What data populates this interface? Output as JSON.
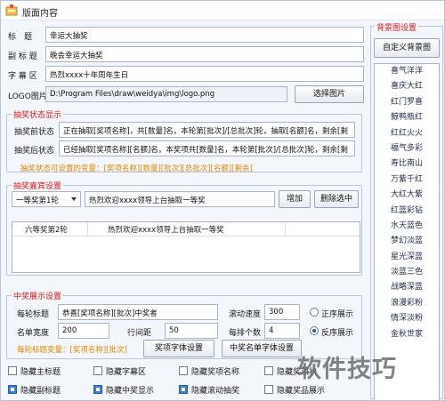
{
  "window": {
    "title": "版面内容"
  },
  "basic": {
    "title_label": "标　题",
    "title_value": "幸运大抽奖",
    "subtitle_label": "副 标 题",
    "subtitle_value": "晚会幸运大抽奖",
    "caption_label": "字 幕 区",
    "caption_value": "热烈xxxx十年周年生日",
    "logo_label": "LOGO图片",
    "logo_value": "D:\\Program Files\\draw\\weidya\\img\\logo.png",
    "select_image_button": "选择图片"
  },
  "status": {
    "group_title": "抽奖状态显示",
    "before_label": "抽奖前状态",
    "before_value": "正在抽取[奖项名称]，共[数量]名，本轮第[批次]/[总批次]轮，抽取[名额]名，剩余[剩",
    "after_label": "抽奖后状态",
    "after_value": "已经抽取[奖项名称][名额]名，本奖项共[数量]名，本轮第[批次]/[总批次]轮，剩余[剩",
    "hint": "抽奖状态可设置的变量：[奖项名称][数量][批次][总批次][名额][剩余]"
  },
  "guests": {
    "group_title": "抽奖嘉宾设置",
    "prize_select": "一等奖第1轮",
    "message_value": "热烈欢迎xxxx领导上台抽取一等奖",
    "add_button": "增加",
    "delete_button": "删除选中",
    "table": {
      "columns": [
        "六等奖第2轮",
        "热烈欢迎xxxx领导上台抽取一等奖"
      ]
    }
  },
  "winners": {
    "group_title": "中奖展示设置",
    "per_round_title_label": "每轮标题",
    "per_round_title_value": "恭喜[奖项名称][批次]中奖者",
    "scroll_speed_label": "滚动速度",
    "scroll_speed_value": "300",
    "order_asc": "正序展示",
    "name_width_label": "名单宽度",
    "name_width_value": "200",
    "line_spacing_label": "行间距",
    "line_spacing_value": "50",
    "per_row_label": "每排个数",
    "per_row_value": "4",
    "order_desc": "反序展示",
    "hint": "每轮标题变量：[奖项名称][批次]",
    "prize_font_button": "奖项字体设置",
    "winner_font_button": "中奖名单字体设置"
  },
  "options": {
    "row1": [
      "隐藏主标题",
      "隐藏字幕区",
      "隐藏奖项名称",
      "隐藏奖项状"
    ],
    "row2": [
      "隐藏副标题",
      "隐藏中奖显示",
      "隐藏滚动抽奖",
      "隐藏奖品展示"
    ]
  },
  "background": {
    "group_title": "背景图设置",
    "custom_button": "自定义背景图",
    "items": [
      "喜气洋洋",
      "喜庆大红",
      "红门罗喜",
      "鲸鸭瓶红",
      "红红火火",
      "福气多彩",
      "寿比南山",
      "万紫千红",
      "大红大紫",
      "红蓝彩钻",
      "水天蓝色",
      "梦幻淡蓝",
      "星光深蓝",
      "淡蓝三色",
      "战略深蓝",
      "浪漫彩粉",
      "情深淡粉",
      "金秋世家"
    ]
  },
  "watermark": "软件技巧"
}
